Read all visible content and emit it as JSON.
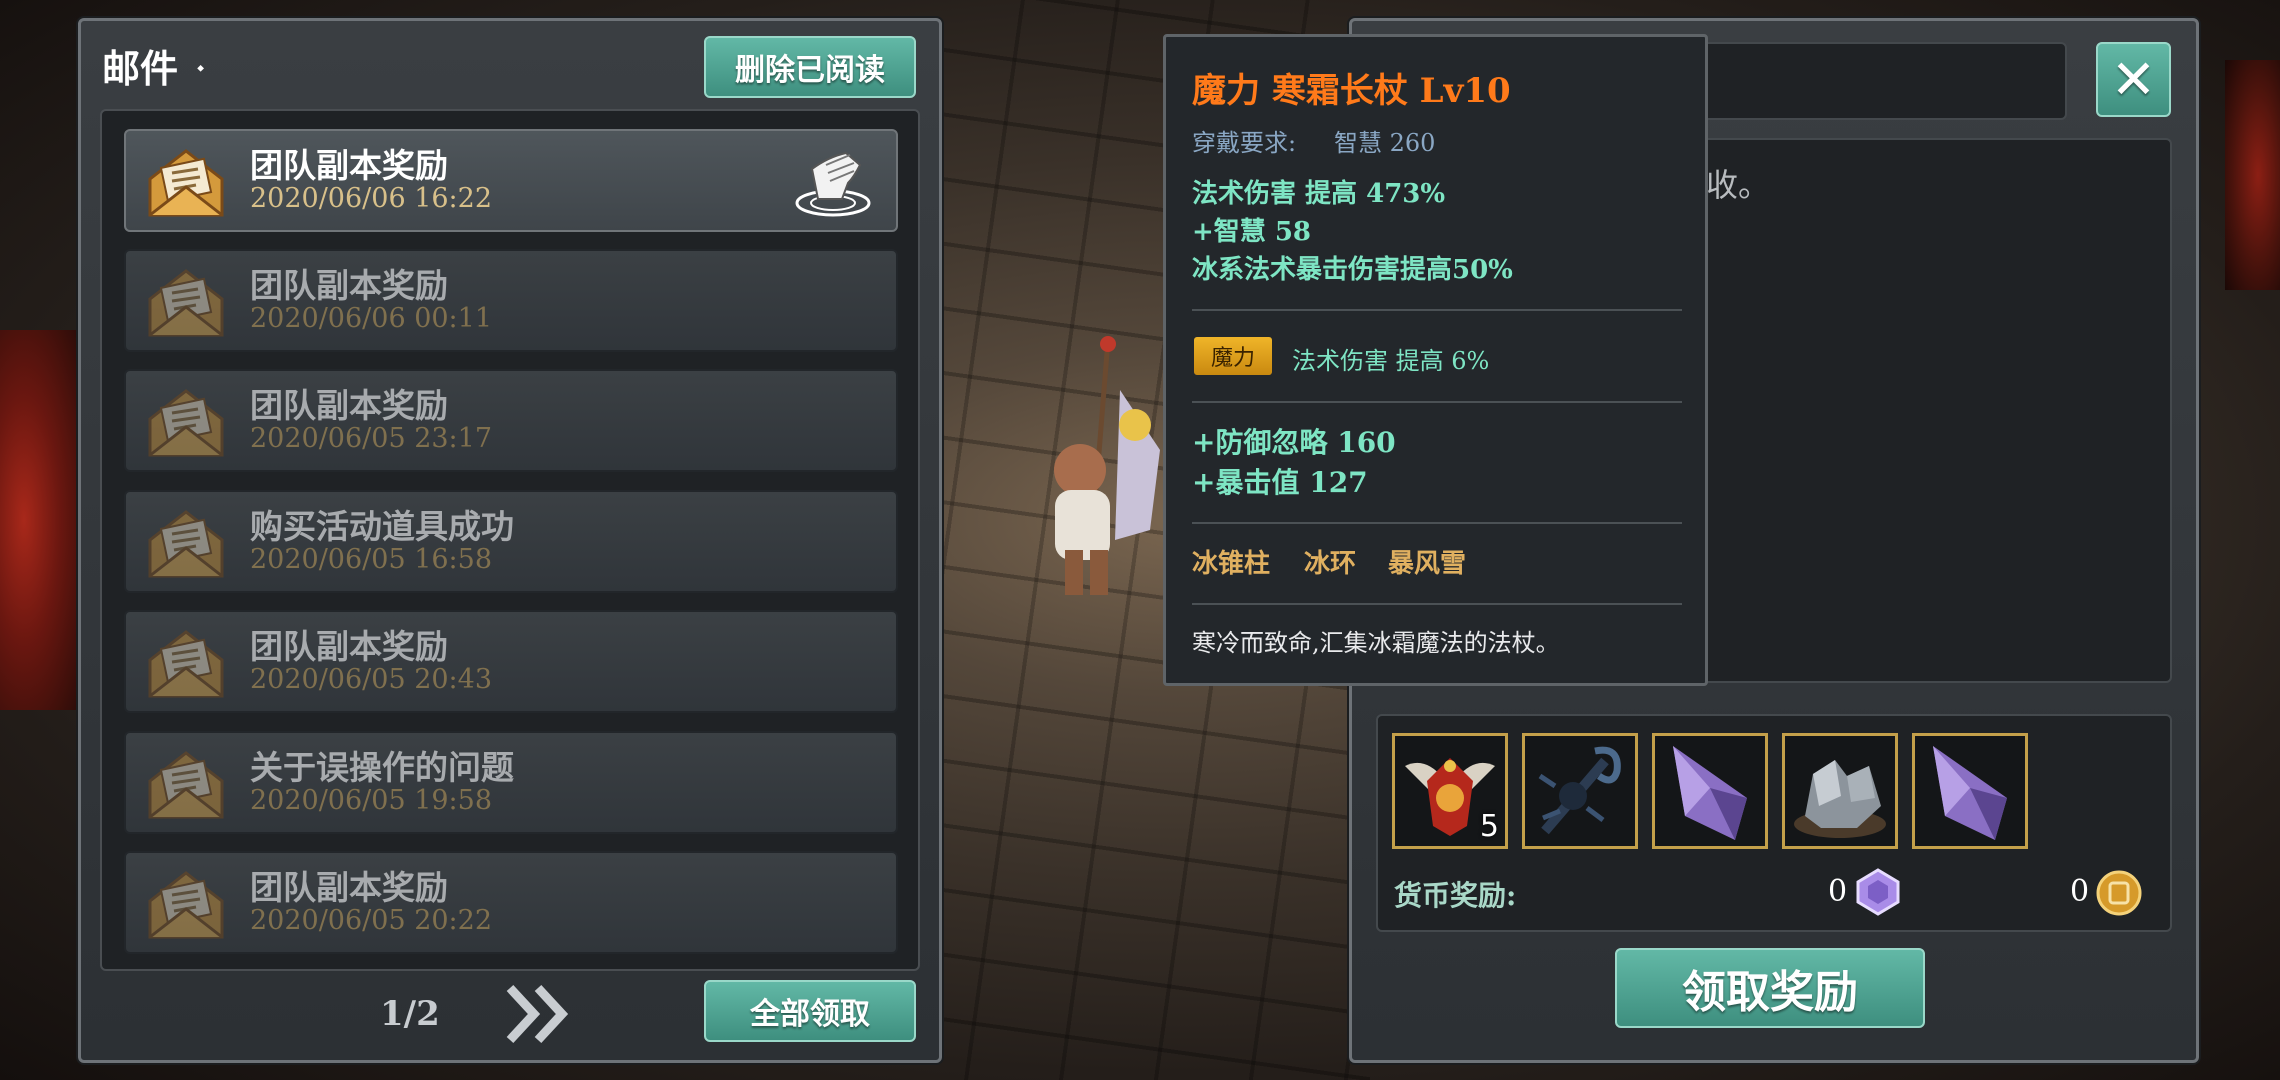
{
  "mail_panel": {
    "title": "邮件",
    "delete_read_label": "删除已阅读",
    "claim_all_label": "全部领取",
    "page_indicator": "1/2",
    "items": [
      {
        "title": "团队副本奖励",
        "date": "2020/06/06  16:22",
        "active": true
      },
      {
        "title": "团队副本奖励",
        "date": "2020/06/06  00:11",
        "active": false
      },
      {
        "title": "团队副本奖励",
        "date": "2020/06/05  23:17",
        "active": false
      },
      {
        "title": "购买活动道具成功",
        "date": "2020/06/05  16:58",
        "active": false
      },
      {
        "title": "团队副本奖励",
        "date": "2020/06/05  20:43",
        "active": false
      },
      {
        "title": "关于误操作的问题",
        "date": "2020/06/05  19:58",
        "active": false
      },
      {
        "title": "团队副本奖励",
        "date": "2020/06/05  20:22",
        "active": false
      }
    ]
  },
  "tooltip": {
    "name": "魔力  寒霜长杖  Lv10",
    "requirement_label": "穿戴要求:",
    "requirement_value": "智慧  260",
    "stats": [
      "法术伤害  提高  473%",
      "+智慧  58",
      "冰系法术暴击伤害提高50%"
    ],
    "affix_badge": "魔力",
    "affix_text": "法术伤害  提高  6%",
    "bonus_stats": [
      "+防御忽略  160",
      "+暴击值  127"
    ],
    "skills": [
      "冰锥柱",
      "冰环",
      "暴风雪"
    ],
    "description": "寒冷而致命,汇集冰霜魔法的法杖。"
  },
  "detail_panel": {
    "body_text_fragment": "收。",
    "reward_items": [
      {
        "name": "winged-crest-emblem",
        "count": "5"
      },
      {
        "name": "dark-scorpion-staff",
        "count": ""
      },
      {
        "name": "purple-crystal-shard",
        "count": ""
      },
      {
        "name": "grey-ore-chunk",
        "count": ""
      },
      {
        "name": "purple-crystal-shard",
        "count": ""
      }
    ],
    "currency_label": "货币奖励:",
    "gem_amount": "0",
    "coin_amount": "0",
    "claim_label": "领取奖励"
  },
  "colors": {
    "accent_teal": "#4fa392",
    "item_name_orange": "#ff7a1a",
    "stat_green": "#7ee5c4",
    "skill_gold": "#e0b060",
    "slot_border_gold": "#c4a04a"
  }
}
